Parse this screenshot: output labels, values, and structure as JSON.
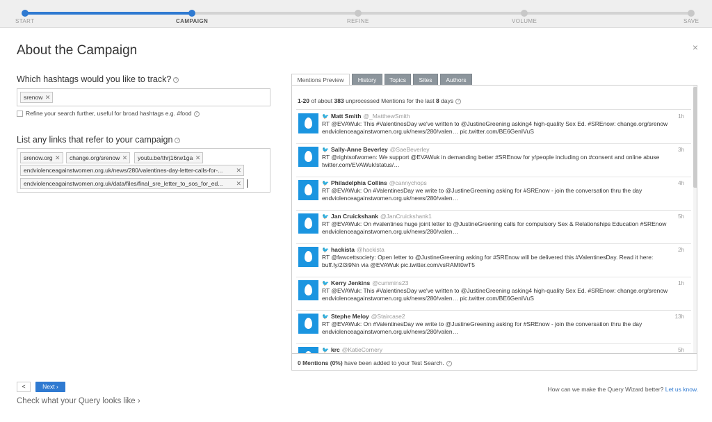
{
  "wizard": {
    "steps": [
      "START",
      "CAMPAIGN",
      "REFINE",
      "VOLUME",
      "SAVE"
    ],
    "active_step": "CAMPAIGN",
    "close_label": "×"
  },
  "page": {
    "title": "About the Campaign",
    "hashtags_label": "Which hashtags would you like to track?",
    "hashtags": [
      "srenow"
    ],
    "refine_label": "Refine your search further, useful for broad hashtags e.g. #food",
    "links_label": "List any links that refer to your campaign",
    "links": [
      "srenow.org",
      "change.org/srenow",
      "youtu.be/thrj16rw1ga",
      "endviolenceagainstwomen.org.uk/news/280/valentines-day-letter-calls-for-...",
      "endviolenceagainstwomen.org.uk/data/files/final_sre_letter_to_sos_for_ed..."
    ],
    "back_label": "<",
    "next_label": "Next ›",
    "check_query_label": "Check what your Query looks like ›",
    "feedback_text": "How can we make the Query Wizard better?",
    "feedback_link": "Let us know."
  },
  "preview": {
    "tabs": [
      "Mentions Preview",
      "History",
      "Topics",
      "Sites",
      "Authors"
    ],
    "active_tab": "Mentions Preview",
    "summary_range": "1-20",
    "summary_mid": "of about",
    "summary_count": "383",
    "summary_mid2": "unprocessed Mentions for the last",
    "summary_days": "8",
    "summary_end": "days",
    "footer_bold": "0 Mentions (0%)",
    "footer_text": "have been added to your Test Search.",
    "mentions": [
      {
        "name": "Matt Smith",
        "handle": "@_MatthewSmith",
        "time": "1h",
        "text": "RT @EVAWuk: This #ValentinesDay we've written to @JustineGreening asking4 high-quality Sex Ed. #SREnow: change.org/srenow endviolenceagainstwomen.org.uk/news/280/valen… pic.twitter.com/BE6GenIVuS"
      },
      {
        "name": "Sally-Anne Beverley",
        "handle": "@SaeBeverley",
        "time": "3h",
        "text": "RT @rightsofwomen: We support @EVAWuk in demanding better #SREnow for y/people including on #consent and online abuse twitter.com/EVAWuk/status/…"
      },
      {
        "name": "Philadelphia Collins",
        "handle": "@cannychops",
        "time": "4h",
        "text": "RT @EVAWuk: On #ValentinesDay we write to @JustineGreening asking for #SREnow - join the conversation thru the day endviolenceagainstwomen.org.uk/news/280/valen…"
      },
      {
        "name": "Jan Cruickshank",
        "handle": "@JanCruickshank1",
        "time": "5h",
        "text": "RT @EVAWuk: On #valentines huge joint letter to @JustineGreening calls for compulsory Sex & Relationships Education #SREnow endviolenceagainstwomen.org.uk/news/280/valen…"
      },
      {
        "name": "hackista",
        "handle": "@hackista",
        "time": "2h",
        "text": "RT @fawcettsociety: Open letter to @JustineGreening asking for #SREnow will be delivered this #ValentinesDay. Read it here: buff.ly/2l3i9Nn via @EVAWuk pic.twitter.com/vsRAMt0wT5"
      },
      {
        "name": "Kerry Jenkins",
        "handle": "@cummins23",
        "time": "1h",
        "text": "RT @EVAWuk: This #ValentinesDay we've written to @JustineGreening asking4 high-quality Sex Ed. #SREnow: change.org/srenow endviolenceagainstwomen.org.uk/news/280/valen… pic.twitter.com/BE6GenIVuS"
      },
      {
        "name": "Stephe Meloy",
        "handle": "@Staircase2",
        "time": "13h",
        "text": "RT @EVAWuk: On #ValentinesDay we write to @JustineGreening asking for #SREnow - join the conversation thru the day endviolenceagainstwomen.org.uk/news/280/valen…"
      },
      {
        "name": "krc",
        "handle": "@KatieCornery",
        "time": "5h",
        "text": ""
      }
    ]
  }
}
